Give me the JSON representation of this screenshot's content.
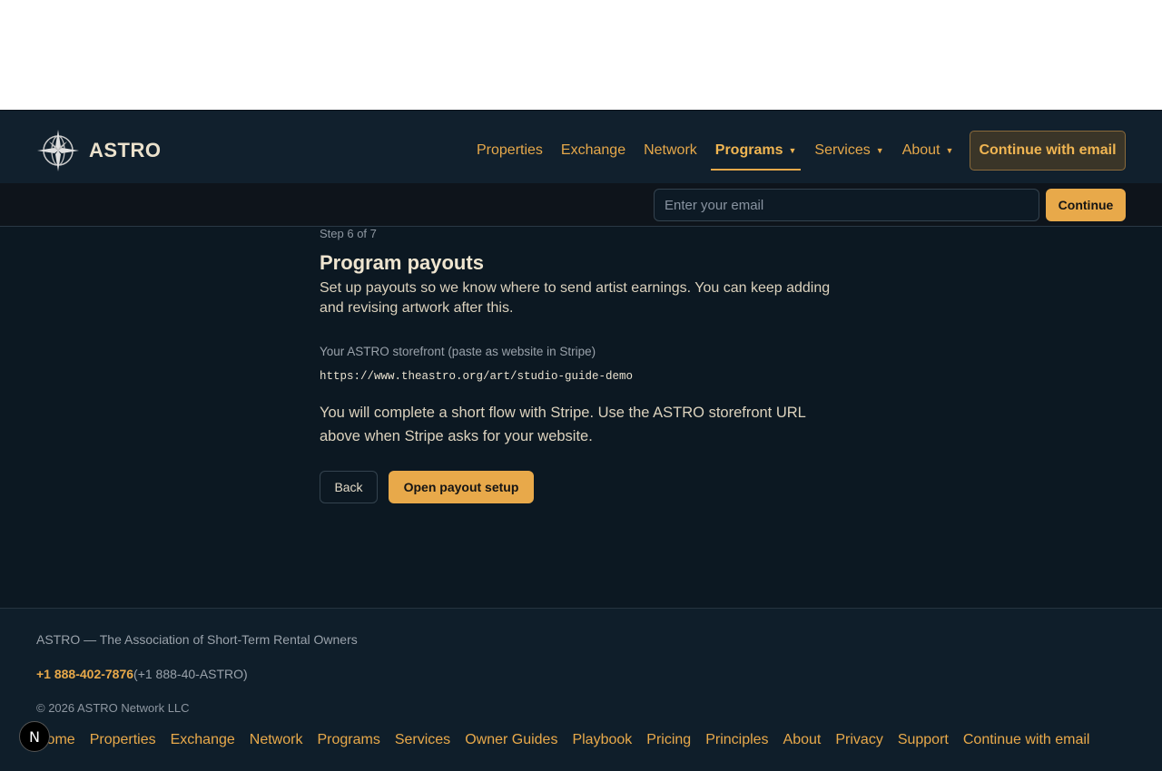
{
  "header": {
    "logo_text": "ASTRO",
    "nav": [
      {
        "label": "Properties",
        "dropdown": false
      },
      {
        "label": "Exchange",
        "dropdown": false
      },
      {
        "label": "Network",
        "dropdown": false
      },
      {
        "label": "Programs",
        "dropdown": true,
        "active": true
      },
      {
        "label": "Services",
        "dropdown": true
      },
      {
        "label": "About",
        "dropdown": true
      }
    ],
    "cta_label": "Continue with email"
  },
  "email_bar": {
    "placeholder": "Enter your email",
    "value": "",
    "button_label": "Continue"
  },
  "main": {
    "step": "Step 6 of 7",
    "title": "Program payouts",
    "subtitle": "Set up payouts so we know where to send artist earnings. You can keep adding and revising artwork after this.",
    "storefront_label": "Your ASTRO storefront (paste as website in Stripe)",
    "storefront_url": "https://www.theastro.org/art/studio-guide-demo",
    "description": "You will complete a short flow with Stripe. Use the ASTRO storefront URL above when Stripe asks for your website.",
    "back_label": "Back",
    "open_label": "Open payout setup"
  },
  "footer": {
    "association": "ASTRO — The Association of Short-Term Rental Owners",
    "phone": "+1 888-402-7876",
    "phone_alt": "(+1 888-40-ASTRO)",
    "copyright": "© 2026 ASTRO Network LLC",
    "links": [
      "Home",
      "Properties",
      "Exchange",
      "Network",
      "Programs",
      "Services",
      "Owner Guides",
      "Playbook",
      "Pricing",
      "Principles",
      "About",
      "Privacy",
      "Support",
      "Continue with email"
    ]
  },
  "badge": {
    "letter": "N"
  },
  "colors": {
    "accent": "#e8a94a",
    "background": "#0c1822",
    "header": "#11202d"
  }
}
